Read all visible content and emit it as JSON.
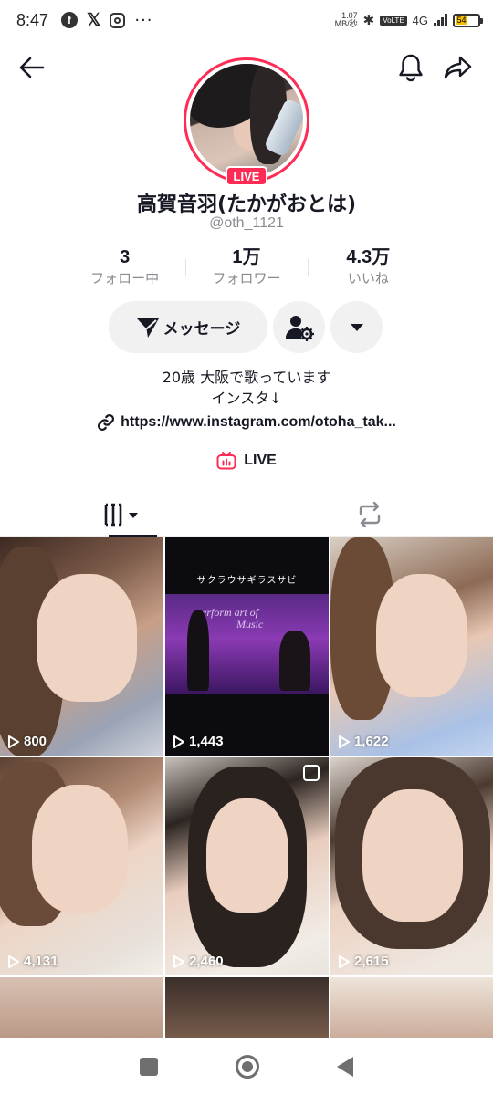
{
  "status_bar": {
    "time": "8:47",
    "net_speed_top": "1.07",
    "net_speed_bottom": "MB/秒",
    "volte": "VoLTE",
    "network": "4G",
    "battery": "54",
    "battery_level": 0.54
  },
  "profile": {
    "live_badge": "LIVE",
    "display_name": "高賀音羽(たかがおとは)",
    "username": "@oth_1121",
    "stats": [
      {
        "value": "3",
        "label": "フォロー中"
      },
      {
        "value": "1万",
        "label": "フォロワー"
      },
      {
        "value": "4.3万",
        "label": "いいね"
      }
    ],
    "message_label": "メッセージ",
    "bio_line1": "20歳 大阪で歌っています",
    "bio_line2": "インスタ↓",
    "link": "https://www.instagram.com/otoha_tak...",
    "live_label": "LIVE"
  },
  "videos": [
    {
      "views": "800"
    },
    {
      "views": "1,443",
      "overlay_title": "サクラウサギラスサビ",
      "overlay_text1": "erform art of",
      "overlay_text2": "Music"
    },
    {
      "views": "1,622"
    },
    {
      "views": "4,131"
    },
    {
      "views": "2,460"
    },
    {
      "views": "2,615"
    },
    {},
    {},
    {}
  ],
  "colors": {
    "accent": "#fe2c55",
    "text": "#161823",
    "muted": "#8a8b91",
    "button_bg": "#f1f1f2"
  },
  "icons": {
    "header": [
      "back-arrow-icon",
      "bell-icon",
      "share-icon"
    ],
    "tabs": [
      "videos-grid-icon",
      "repost-icon"
    ],
    "nav": [
      "recents-icon",
      "home-icon",
      "back-icon"
    ]
  }
}
